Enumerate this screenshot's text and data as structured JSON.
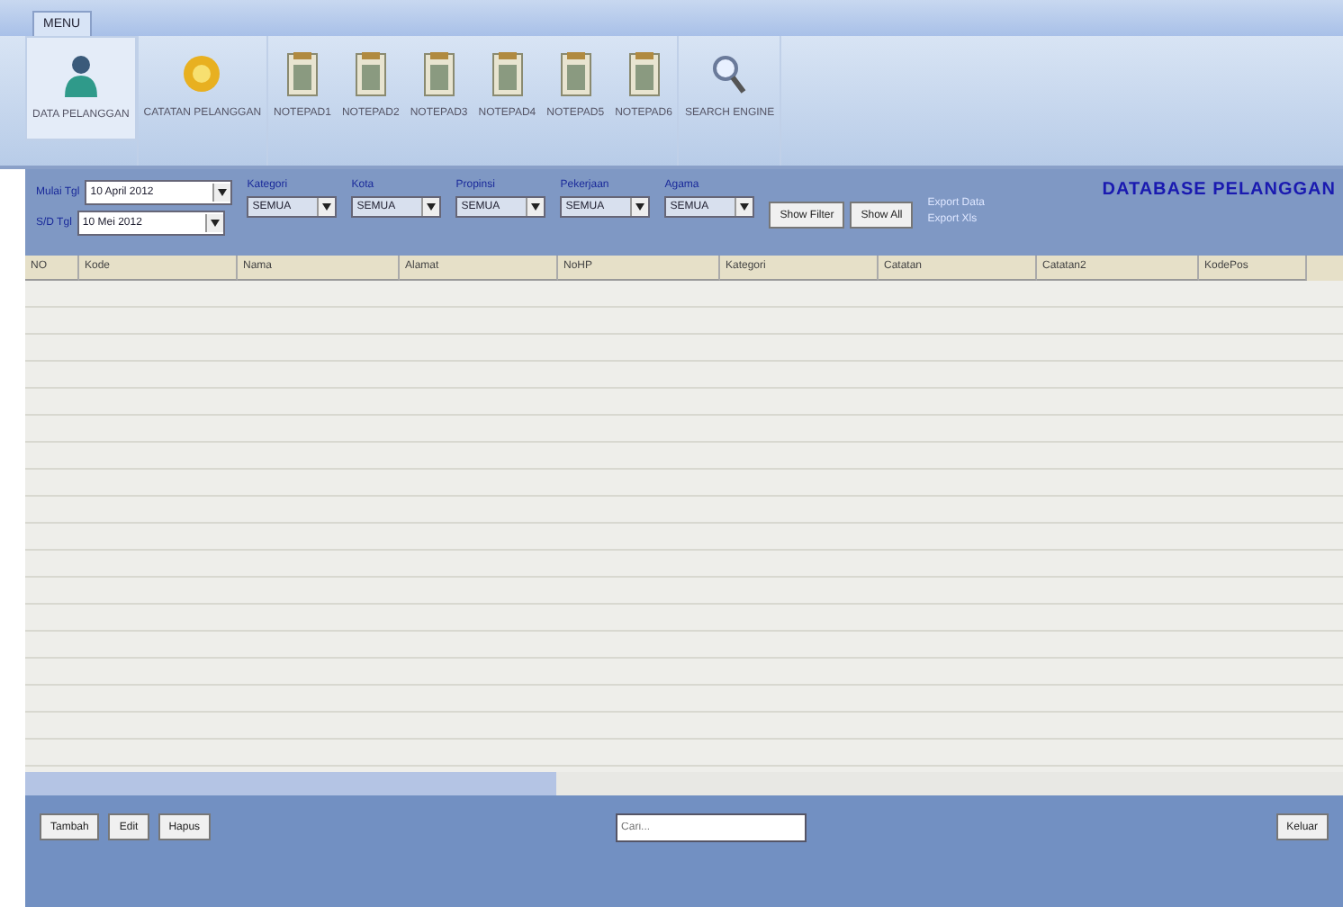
{
  "menu_tab": {
    "label": "MENU",
    "selected": true
  },
  "ribbon": [
    {
      "label": "DATA PELANGGAN",
      "kind": "person",
      "selected": true
    },
    {
      "label": "CATATAN PELANGGAN",
      "kind": "badge",
      "selected": false
    },
    {
      "label": "NOTEPAD1",
      "kind": "note",
      "selected": false
    },
    {
      "label": "NOTEPAD2",
      "kind": "note",
      "selected": false
    },
    {
      "label": "NOTEPAD3",
      "kind": "note",
      "selected": false
    },
    {
      "label": "NOTEPAD4",
      "kind": "note",
      "selected": false
    },
    {
      "label": "NOTEPAD5",
      "kind": "note",
      "selected": false
    },
    {
      "label": "NOTEPAD6",
      "kind": "note",
      "selected": false
    },
    {
      "label": "SEARCH ENGINE",
      "kind": "search",
      "selected": false
    }
  ],
  "filter": {
    "date_from": {
      "label": "Mulai Tgl",
      "value": "10 April 2012"
    },
    "date_to": {
      "label": "S/D Tgl",
      "value": "10 Mei 2012"
    },
    "dropdowns": [
      {
        "label": "Kategori",
        "value": "SEMUA"
      },
      {
        "label": "Kota",
        "value": "SEMUA"
      },
      {
        "label": "Propinsi",
        "value": "SEMUA"
      },
      {
        "label": "Pekerjaan",
        "value": "SEMUA"
      },
      {
        "label": "Agama",
        "value": "SEMUA"
      }
    ],
    "buttons": [
      "Show Filter",
      "Show All"
    ],
    "links": [
      "Export Data",
      "Export Xls"
    ],
    "title": "DATABASE PELANGGAN"
  },
  "table": {
    "columns": [
      "NO",
      "Kode",
      "Nama",
      "Alamat",
      "NoHP",
      "Kategori",
      "Catatan",
      "Catatan2",
      "KodePos"
    ]
  },
  "footer": {
    "buttons": [
      "Tambah",
      "Edit",
      "Hapus"
    ],
    "search": {
      "placeholder": "Cari..."
    },
    "exit": "Keluar"
  }
}
